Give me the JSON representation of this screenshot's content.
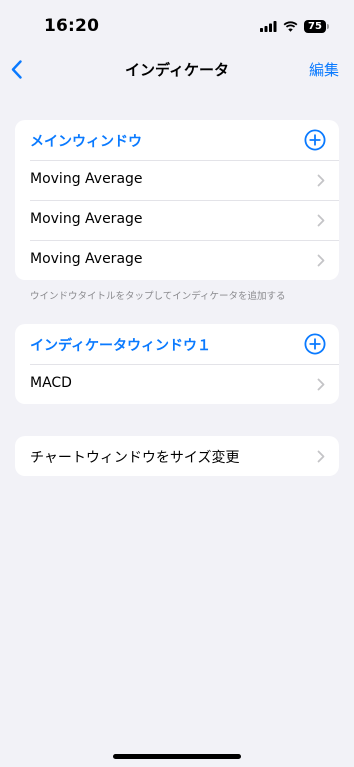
{
  "status_bar": {
    "time": "16:20",
    "battery_level": "75",
    "icons": [
      "signal-bars-icon",
      "wifi-icon",
      "battery-icon"
    ]
  },
  "nav": {
    "back_icon": "chevron-left-icon",
    "title": "インディケータ",
    "edit_label": "編集"
  },
  "main_window": {
    "header": "メインウィンドウ",
    "add_icon": "plus-circle-icon",
    "items": [
      {
        "label": "Moving Average"
      },
      {
        "label": "Moving Average"
      },
      {
        "label": "Moving Average"
      }
    ],
    "footer": "ウインドウタイトルをタップしてインディケータを追加する"
  },
  "indicator_window": {
    "header": "インディケータウィンドウ１",
    "add_icon": "plus-circle-icon",
    "items": [
      {
        "label": "MACD"
      }
    ]
  },
  "resize": {
    "label": "チャートウィンドウをサイズ変更"
  },
  "colors": {
    "accent": "#0a7aff",
    "background": "#f2f2f7",
    "card": "#ffffff",
    "chevron": "#c4c4c7",
    "footer_text": "#8a8a8e"
  }
}
